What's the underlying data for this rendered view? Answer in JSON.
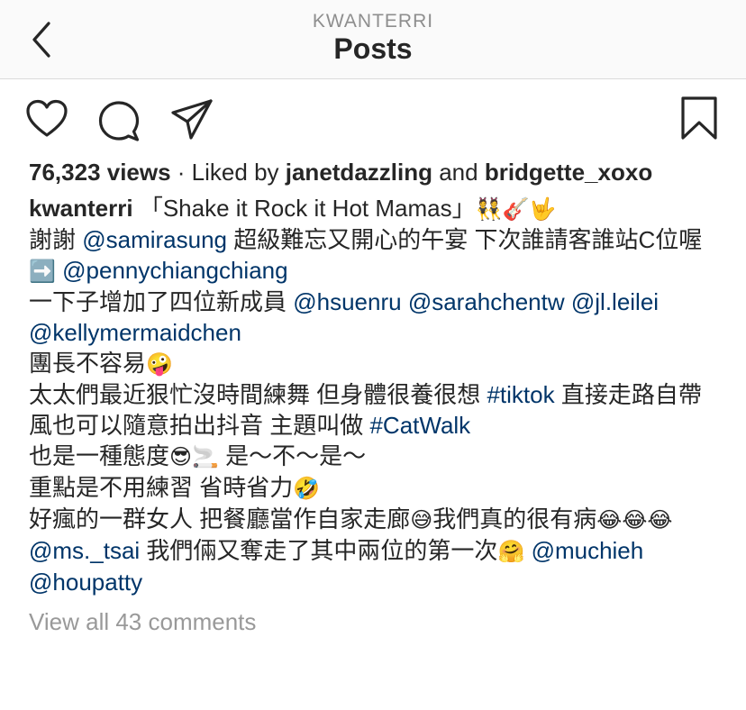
{
  "header": {
    "username": "KWANTERRI",
    "title": "Posts"
  },
  "icons": {
    "back": "chevron-left-icon",
    "like": "heart-icon",
    "comment": "comment-bubble-icon",
    "share": "paper-plane-icon",
    "save": "bookmark-icon"
  },
  "colors": {
    "link": "#003569",
    "muted": "#999999",
    "text": "#262626",
    "header_bg": "#fafafa"
  },
  "post": {
    "views": "76,323 views",
    "liked_prefix": " · Liked by ",
    "liker1": "janetdazzling",
    "liked_and": " and ",
    "liker2": "bridgette_xoxo",
    "caption": {
      "author": "kwanterri",
      "l1_text": " 「Shake it Rock it Hot Mamas」",
      "l1_emoji": "👯🎸🤟",
      "l2_pre": "謝謝 ",
      "l2_mention": "@samirasung",
      "l2_post": " 超級難忘又開心的午宴 下次誰請客誰站C位喔",
      "l3_emoji": "➡️",
      "l3_mention": "@pennychiangchiang",
      "l4_pre": "一下子增加了四位新成員 ",
      "l4_m1": "@hsuenru",
      "l4_m2": "@sarahchentw",
      "l4_m3": "@jl.leilei",
      "l4_m4": "@kellymermaidchen",
      "l5_text": "團長不容易",
      "l5_emoji": "🤪",
      "l6_pre": "太太們最近狠忙沒時間練舞 但身體很養很想 ",
      "l6_tag1": "#tiktok",
      "l6_mid": " 直接走路自帶風也可以隨意拍出抖音 主題叫做 ",
      "l6_tag2": "#CatWalk",
      "l7_pre": "也是一種態度",
      "l7_emoji": "😎🚬",
      "l7_post": " 是～不～是～",
      "l8_text": "重點是不用練習 省時省力",
      "l8_emoji": "🤣",
      "l9_text1": "好瘋的一群女人 把餐廳當作自家走廊",
      "l9_emoji1": "😅",
      "l9_text2": "我們真的很有病",
      "l9_emoji2": "😂😂😂",
      "l10_mention1": "@ms._tsai",
      "l10_text": " 我們倆又奪走了其中兩位的第一次",
      "l10_emoji": "🤗",
      "l10_mention2": "@muchieh",
      "l10_mention3": "@houpatty"
    },
    "view_all_comments": "View all 43 comments"
  }
}
